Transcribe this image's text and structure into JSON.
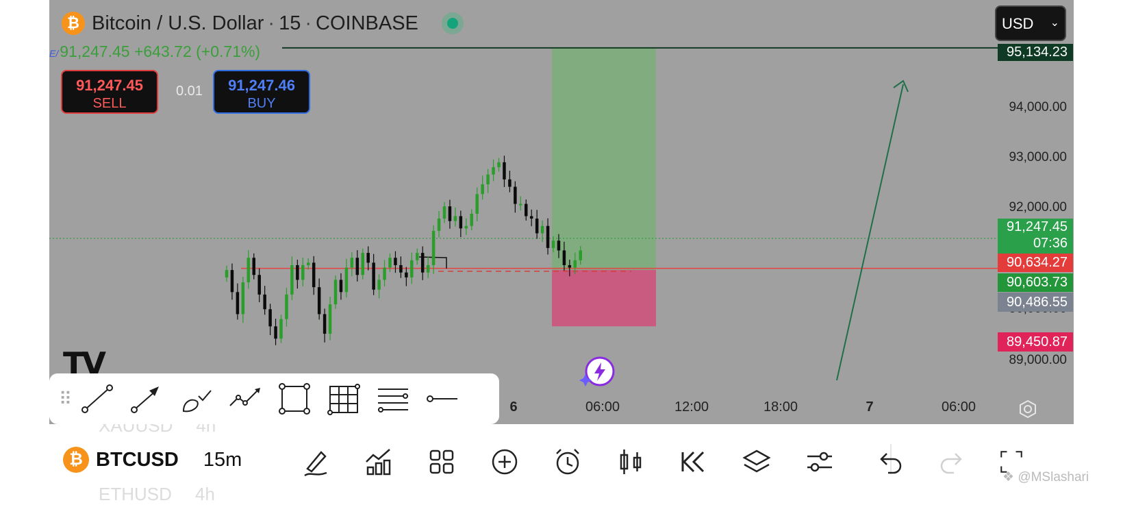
{
  "header": {
    "symbol_icon": "bitcoin-logo",
    "symbol_description": "Bitcoin / U.S. Dollar",
    "interval": "15",
    "exchange": "COINBASE",
    "separator": "·"
  },
  "quote": {
    "prefix": "E/",
    "last": "91,247.45",
    "change": "+643.72",
    "change_pct": "(+0.71%)"
  },
  "trade": {
    "sell_price": "91,247.45",
    "sell_label": "SELL",
    "buy_price": "91,247.46",
    "buy_label": "BUY",
    "lot": "0.01"
  },
  "currency_selector": {
    "value": "USD"
  },
  "price_axis": {
    "ticks": [
      "94,000.00",
      "93,000.00",
      "92,000.00",
      "90,000.00",
      "89,000.00"
    ],
    "labels": {
      "target": "95,134.23",
      "current_price": "91,247.45",
      "countdown": "07:36",
      "resistance": "90,634.27",
      "entry": "90,603.73",
      "neutral": "90,486.55",
      "stop": "89,450.87"
    }
  },
  "time_axis": {
    "ticks": [
      "6",
      "06:00",
      "12:00",
      "18:00",
      "7",
      "06:00"
    ]
  },
  "drawing_toolbar": {
    "tools": [
      "trend-line-icon",
      "arrow-line-icon",
      "brush-icon",
      "path-icon",
      "rectangle-icon",
      "grid-icon",
      "parallel-lines-icon",
      "horizontal-ray-icon"
    ]
  },
  "watchlist": {
    "above": {
      "symbol": "XAUUSD",
      "interval": "4h"
    },
    "active": {
      "symbol": "BTCUSD",
      "interval": "15m"
    },
    "below": {
      "symbol": "ETHUSD",
      "interval": "4h"
    }
  },
  "bottom_toolbar": {
    "icons": [
      "draw-icon",
      "indicators-icon",
      "templates-icon",
      "add-icon",
      "alert-icon",
      "chart-type-icon",
      "replay-icon",
      "layers-icon",
      "settings-icon",
      "undo-icon",
      "redo-icon",
      "fullscreen-icon"
    ]
  },
  "watermark": "@MSlashari",
  "colors": {
    "chart_bg": "#a0a0a0",
    "up_candle": "#2a9d2a",
    "down_candle": "#0b0b0b",
    "profit_zone": "#80ac80",
    "loss_zone": "#c95b80",
    "resistance_line": "#e8413f",
    "brand_orange": "#f7931a"
  },
  "chart_data": {
    "type": "candlestick",
    "symbol": "BTCUSD",
    "interval": "15m",
    "ylim": [
      88800,
      95300
    ],
    "close_series": [
      90600,
      90150,
      89700,
      90350,
      90850,
      90500,
      90100,
      89800,
      89450,
      89200,
      89600,
      90100,
      90700,
      90400,
      90700,
      90750,
      90250,
      89700,
      89300,
      89900,
      90400,
      90150,
      90650,
      90850,
      90500,
      90950,
      90750,
      90200,
      90400,
      90650,
      90850,
      90700,
      90550,
      90450,
      90800,
      90950,
      90550,
      90700,
      91400,
      91650,
      91900,
      91600,
      91700,
      91450,
      91500,
      91750,
      92150,
      92350,
      92550,
      92700,
      92800,
      92450,
      92300,
      91950,
      91950,
      91700,
      91650,
      91350,
      91500,
      91050,
      91200,
      91000,
      90700,
      90650,
      90800,
      91000
    ],
    "positions": {
      "long_position": {
        "entry": 90603.73,
        "target": 95134.23,
        "stop": 89450.87
      }
    },
    "horizontal_lines": [
      90603.73,
      90634.27
    ],
    "current_price": 91247.45
  }
}
